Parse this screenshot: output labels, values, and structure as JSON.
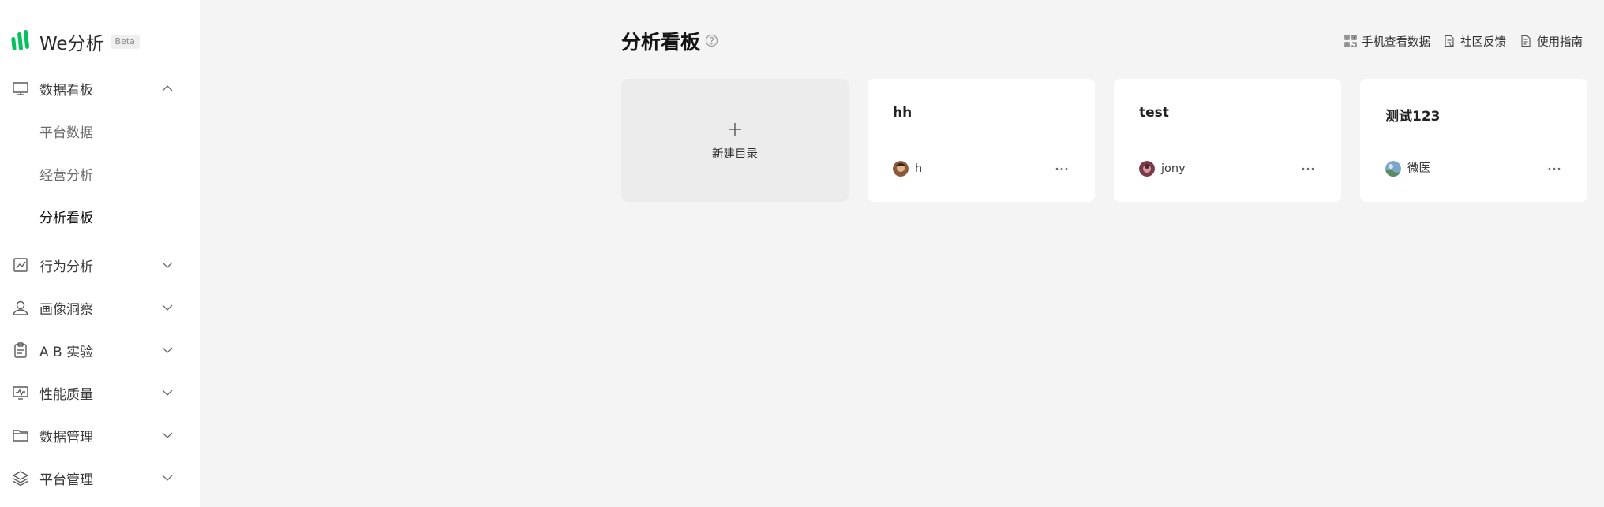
{
  "app": {
    "brand": "We分析",
    "beta_label": "Beta",
    "accent_color": "#07c160"
  },
  "sidebar": {
    "menus": [
      {
        "label": "数据看板",
        "icon": "monitor-icon",
        "expanded": true,
        "children": [
          {
            "label": "平台数据",
            "active": false
          },
          {
            "label": "经营分析",
            "active": false
          },
          {
            "label": "分析看板",
            "active": true
          }
        ]
      },
      {
        "label": "行为分析",
        "icon": "chart-trend-icon",
        "expanded": false
      },
      {
        "label": "画像洞察",
        "icon": "user-portrait-icon",
        "expanded": false
      },
      {
        "label": "A B 实验",
        "icon": "clipboard-icon",
        "expanded": false
      },
      {
        "label": "性能质量",
        "icon": "pulse-monitor-icon",
        "expanded": false
      },
      {
        "label": "数据管理",
        "icon": "folder-icon",
        "expanded": false
      },
      {
        "label": "平台管理",
        "icon": "layers-icon",
        "expanded": false
      }
    ]
  },
  "header": {
    "title": "分析看板",
    "links": [
      {
        "label": "手机查看数据",
        "icon": "qr-code-icon"
      },
      {
        "label": "社区反馈",
        "icon": "feedback-doc-icon"
      },
      {
        "label": "使用指南",
        "icon": "guide-doc-icon"
      }
    ]
  },
  "dashboards": {
    "new_label": "新建目录",
    "items": [
      {
        "title": "hh",
        "owner": "h"
      },
      {
        "title": "test",
        "owner": "jony"
      },
      {
        "title": "测试123",
        "owner": "微医"
      }
    ]
  }
}
